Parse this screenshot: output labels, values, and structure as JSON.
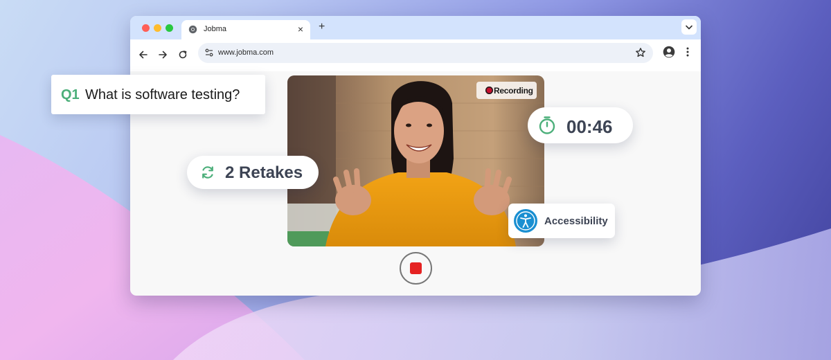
{
  "browser": {
    "tab_title": "Jobma",
    "url": "www.jobma.com",
    "new_tab_label": "+",
    "close_label": "×"
  },
  "interview": {
    "question_number": "Q1",
    "question_text": "What is software testing?",
    "recording_label": "Recording",
    "timer": "00:46",
    "retakes": "2 Retakes",
    "accessibility_label": "Accessibility"
  },
  "colors": {
    "accent_green": "#4caf7a",
    "recording_red": "#c8102e",
    "stop_red": "#e52222",
    "accessibility_blue": "#1a8fd1",
    "tab_bar": "#d3e3fd"
  },
  "icons": {
    "retake": "refresh-arrows-icon",
    "timer": "stopwatch-icon",
    "accessibility": "accessibility-person-icon",
    "stop": "stop-icon"
  }
}
